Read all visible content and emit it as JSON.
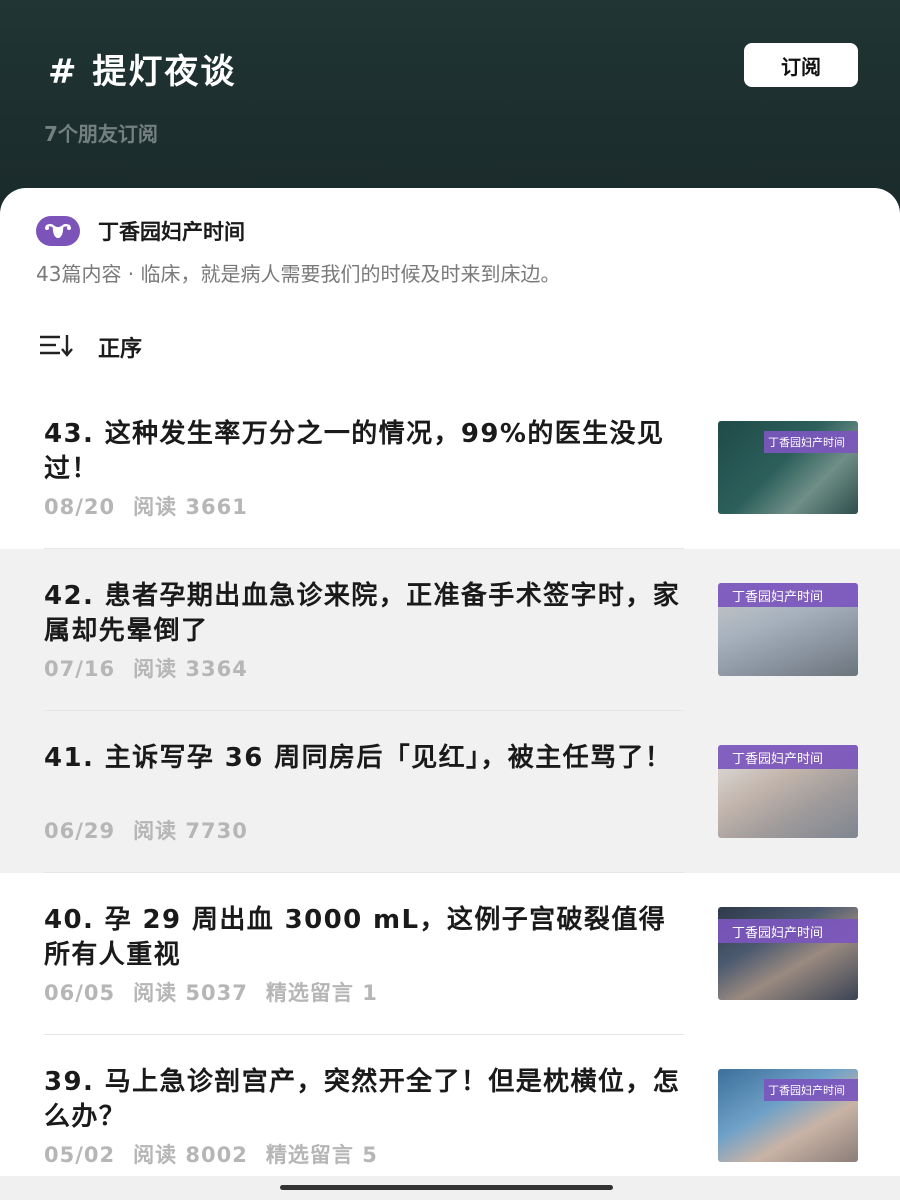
{
  "header": {
    "title": "# 提灯夜谈",
    "subscribers": "7个朋友订阅",
    "subscribe_label": "订阅"
  },
  "account": {
    "name": "丁香园妇产时间",
    "description": "43篇内容 · 临床，就是病人需要我们的时候及时来到床边。",
    "icon": "uterus-icon",
    "brand_color": "#7c53b9"
  },
  "sort": {
    "label": "正序",
    "icon": "sort-order-icon"
  },
  "thumb_badge": "丁香园妇产时间",
  "articles": [
    {
      "title": "43. 这种发生率万分之一的情况，99%的医生没见过！",
      "date": "08/20",
      "reads": "阅读 3661",
      "comments": ""
    },
    {
      "title": "42. 患者孕期出血急诊来院，正准备手术签字时，家属却先晕倒了",
      "date": "07/16",
      "reads": "阅读 3364",
      "comments": ""
    },
    {
      "title": "41. 主诉写孕 36 周同房后「见红」，被主任骂了！",
      "date": "06/29",
      "reads": "阅读 7730",
      "comments": ""
    },
    {
      "title": "40. 孕 29 周出血 3000 mL，这例子宫破裂值得所有人重视",
      "date": "06/05",
      "reads": "阅读 5037",
      "comments": "精选留言 1"
    },
    {
      "title": "39. 马上急诊剖宫产，突然开全了！但是枕横位，怎么办？",
      "date": "05/02",
      "reads": "阅读 8002",
      "comments": "精选留言 5"
    }
  ]
}
